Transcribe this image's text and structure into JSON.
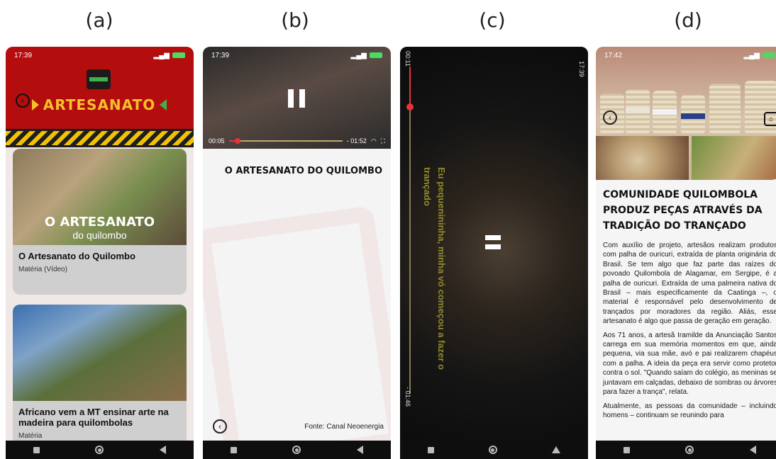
{
  "panel_labels": [
    "(a)",
    "(b)",
    "(c)",
    "(d)"
  ],
  "phone_a": {
    "status_time": "17:39",
    "logo_text": "ARTESANATO",
    "cards": [
      {
        "image_title": "O ARTESANATO",
        "image_subtitle": "do quilombo",
        "title": "O Artesanato do Quilombo",
        "subtitle": "Matéria (Vídeo)"
      },
      {
        "title": "Africano vem a MT ensinar arte na madeira para quilombolas",
        "subtitle": "Matéria"
      }
    ]
  },
  "phone_b": {
    "status_time": "17:39",
    "elapsed": "00:05",
    "remaining": "- 01:52",
    "progress": 0.08,
    "title": "O ARTESANATO DO QUILOMBO",
    "source": "Fonte: Canal Neoenergia"
  },
  "phone_c": {
    "elapsed": "00:11",
    "remaining": "- 01:46",
    "status_time": "17:39",
    "caption": "Eu pequenininha, minha vó começou a fazer o trançado",
    "progress": 0.12
  },
  "phone_d": {
    "status_time": "17:42",
    "title": "COMUNIDADE QUILOMBOLA PRODUZ PEÇAS ATRAVÉS DA TRADIÇÃO DO TRANÇADO",
    "paragraphs": [
      "Com auxílio de projeto, artesãos realizam produtos com palha de ouricuri, extraída de planta originária do Brasil. Se tem algo que faz parte das raízes do povoado Quilombola de Alagamar, em Sergipe, é a palha de ouricuri. Extraída de uma palmeira nativa do Brasil – mais especificamente da Caatinga –, o material é responsável pelo desenvolvimento de trançados por moradores da região. Aliás, esse artesanato é algo que passa de geração em geração.",
      "Aos 71 anos, a artesã Iramilde da Anunciação Santos carrega em sua memória momentos em que, ainda pequena, via sua mãe, avó e pai realizarem chapéus com a palha. A ideia da peça era servir como protetor contra o sol. \"Quando saíam do colégio, as meninas se juntavam em calçadas, debaixo de sombras ou árvores para fazer a trança\", relata.",
      "Atualmente, as pessoas da comunidade – incluindo homens – continuam se reunindo para"
    ]
  },
  "colors": {
    "red_header": "#b40d0d",
    "gold": "#f4c12a",
    "green": "#3db24a",
    "accent_red": "#e6333a"
  },
  "icons": [
    "back-icon",
    "home-icon",
    "pause-icon",
    "fullscreen-icon",
    "speed-icon",
    "nav-recent-icon",
    "nav-home-icon",
    "nav-back-icon"
  ]
}
